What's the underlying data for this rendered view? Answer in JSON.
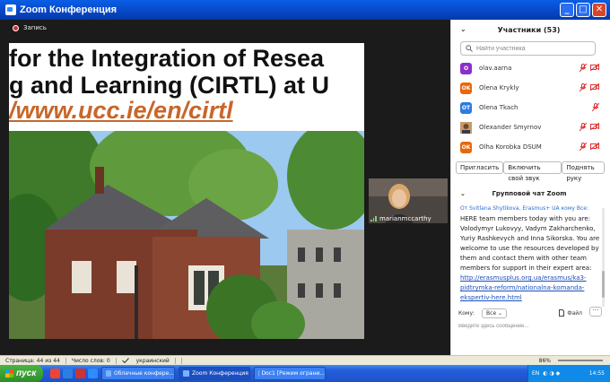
{
  "window": {
    "title": "Zoom Конференция"
  },
  "recording": {
    "label": "Запись"
  },
  "slide": {
    "line1": "for the Integration of Resea",
    "line2": "g and Learning (CIRTL) at U",
    "line3": "/www.ucc.ie/en/cirtl"
  },
  "video_thumb": {
    "name": "marianmccarthy"
  },
  "participants": {
    "header": "Участники (53)",
    "search_placeholder": "Найти участника",
    "list": [
      {
        "initials": "O",
        "name": "olav.aarna",
        "color": "#8b2fc9"
      },
      {
        "initials": "OK",
        "name": "Olena Krykly",
        "color": "#e8670c"
      },
      {
        "initials": "OT",
        "name": "Olena Tkach",
        "color": "#2d7be0"
      },
      {
        "initials": "",
        "name": "Olexander Smyrnov",
        "color": "#b8804a"
      },
      {
        "initials": "OK",
        "name": "Olha Korobka DSUM",
        "color": "#e8670c"
      }
    ],
    "buttons": {
      "invite": "Пригласить",
      "unmute": "Включить свой звук",
      "raise_hand": "Поднять руку"
    }
  },
  "chat": {
    "header": "Групповой чат Zoom",
    "from": "От Svitlana Shytikova, Erasmus+ UA кому Все:",
    "message": "HERE team members today with you are: Volodymyr Lukovyy, Vadym Zakharchenko, Yuriy Rashkevych and Inna Sikorska. You are welcome to use the resources developed by them and contact them with other team members for support in their expert area:",
    "link": "http://erasmusplus.org.ua/erasmus/ka3-pidtrymka-reform/nationalna-komanda-ekspertiv-here.html",
    "to_label": "Кому:",
    "to_value": "Все",
    "file_label": "Файл",
    "input_placeholder": "Введите здесь сообщение..."
  },
  "statusbar": {
    "page": "Страница: 44 из 44",
    "words": "Число слов: 0",
    "language": "украинский",
    "zoom": "86%"
  },
  "taskbar": {
    "start": "пуск",
    "tasks": [
      "Облачные конфере...",
      "Zoom Конференция",
      "Doc1 [Режим ограни..."
    ],
    "lang": "EN",
    "time": "14:55"
  }
}
